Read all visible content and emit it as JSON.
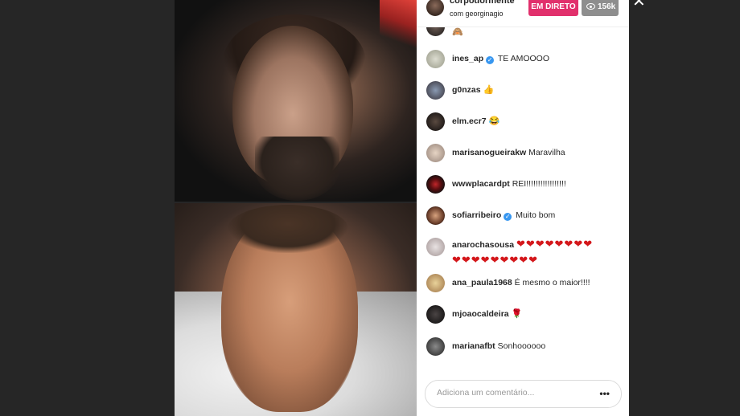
{
  "header": {
    "host_username": "corpodormente",
    "with_line": "com georginagio",
    "live_label": "EM DIRETO",
    "viewers": "156k"
  },
  "comments": [
    {
      "user": "ines_ap",
      "verified": true,
      "text": "TE AMOOOO"
    },
    {
      "user": "g0nzas",
      "verified": false,
      "text": "👍"
    },
    {
      "user": "elm.ecr7",
      "verified": false,
      "text": "😂"
    },
    {
      "user": "marisanogueirakw",
      "verified": false,
      "text": "Maravilha"
    },
    {
      "user": "wwwplacardpt",
      "verified": false,
      "text": "REI!!!!!!!!!!!!!!!!!"
    },
    {
      "user": "sofiarribeiro",
      "verified": true,
      "text": "Muito bom"
    },
    {
      "user": "anarochasousa",
      "verified": false,
      "text": "❤❤❤❤❤❤❤❤",
      "text2": "❤❤❤❤❤❤❤❤❤"
    },
    {
      "user": "ana_paula1968",
      "verified": false,
      "text": "É mesmo o maior!!!!"
    },
    {
      "user": "mjoaocaldeira",
      "verified": false,
      "text": "🌹"
    },
    {
      "user": "marianafbt",
      "verified": false,
      "text": "Sonhoooooo"
    }
  ],
  "partial_comment_emoji": "🙈",
  "comment_box": {
    "placeholder": "Adiciona um comentário...",
    "more_label": "•••"
  },
  "colors": {
    "live_badge": "#e1306c",
    "viewer_badge": "#8e8e8e",
    "verified": "#3897f0",
    "heart": "#d4171b"
  }
}
